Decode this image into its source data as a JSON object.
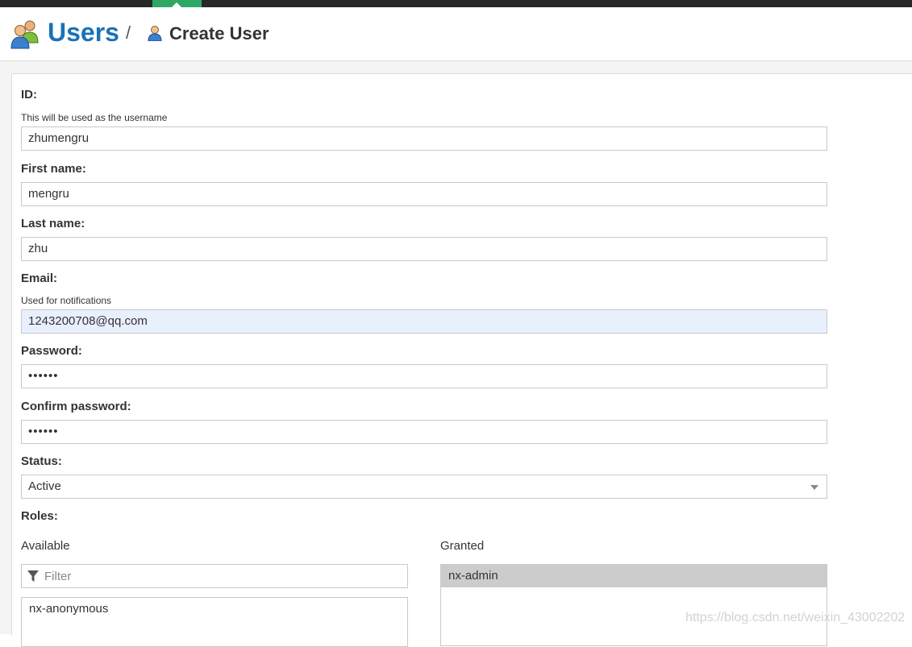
{
  "header": {
    "section_title": "Users",
    "separator": "/",
    "page_title": "Create User",
    "accent_color": "#1a72b8",
    "active_tab_color": "#2fa866"
  },
  "form": {
    "id": {
      "label": "ID:",
      "help": "This will be used as the username",
      "value": "zhumengru"
    },
    "first_name": {
      "label": "First name:",
      "value": "mengru"
    },
    "last_name": {
      "label": "Last name:",
      "value": "zhu"
    },
    "email": {
      "label": "Email:",
      "help": "Used for notifications",
      "value": "1243200708@qq.com"
    },
    "password": {
      "label": "Password:",
      "value": "••••••"
    },
    "confirm_password": {
      "label": "Confirm password:",
      "value": "••••••"
    },
    "status": {
      "label": "Status:",
      "value": "Active"
    },
    "roles": {
      "label": "Roles:",
      "available_label": "Available",
      "granted_label": "Granted",
      "filter_placeholder": "Filter",
      "available": [
        "nx-anonymous"
      ],
      "granted": [
        "nx-admin"
      ]
    }
  },
  "watermark": "https://blog.csdn.net/weixin_43002202"
}
